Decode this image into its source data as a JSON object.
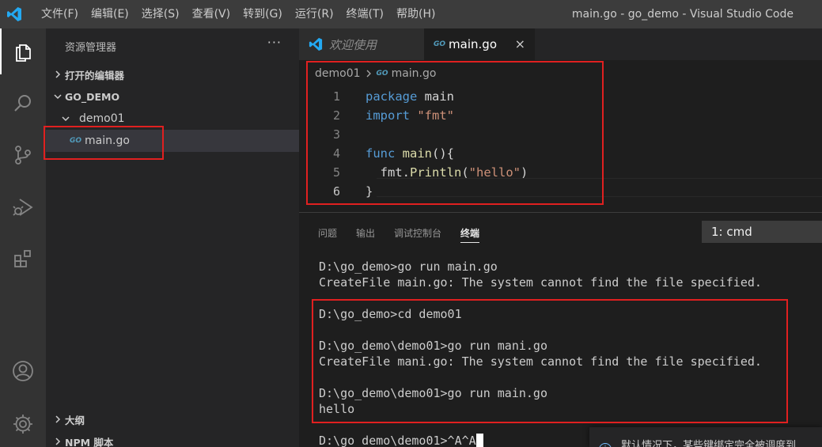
{
  "titlebar": {
    "menu": [
      "文件(F)",
      "编辑(E)",
      "选择(S)",
      "查看(V)",
      "转到(G)",
      "运行(R)",
      "终端(T)",
      "帮助(H)"
    ],
    "window_title": "main.go - go_demo - Visual Studio Code"
  },
  "sidebar": {
    "title": "资源管理器",
    "more": "···",
    "open_editors": "打开的编辑器",
    "workspace": "GO_DEMO",
    "folder": "demo01",
    "file": "main.go",
    "file_icon": "GO",
    "outline": "大纲",
    "npm_scripts": "NPM 脚本"
  },
  "tabs": [
    {
      "label": "欢迎使用",
      "active": false
    },
    {
      "label": "main.go",
      "active": true,
      "icon": "GO",
      "close": "×"
    }
  ],
  "breadcrumb": {
    "folder": "demo01",
    "icon": "GO",
    "file": "main.go"
  },
  "editor": {
    "lines": [
      {
        "n": "1",
        "tokens": [
          [
            "kw",
            "package"
          ],
          [
            "id",
            " main"
          ]
        ]
      },
      {
        "n": "2",
        "tokens": [
          [
            "kw",
            "import"
          ],
          [
            "id",
            " "
          ],
          [
            "st",
            "\"fmt\""
          ]
        ]
      },
      {
        "n": "3",
        "tokens": []
      },
      {
        "n": "4",
        "tokens": [
          [
            "kw",
            "func"
          ],
          [
            "id",
            " "
          ],
          [
            "fn",
            "main"
          ],
          [
            "id",
            "(){"
          ]
        ]
      },
      {
        "n": "5",
        "tokens": [
          [
            "id",
            "  fmt."
          ],
          [
            "fn",
            "Println"
          ],
          [
            "id",
            "("
          ],
          [
            "st",
            "\"hello\""
          ],
          [
            "id",
            ")"
          ]
        ]
      },
      {
        "n": "6",
        "tokens": [
          [
            "id",
            "}"
          ]
        ]
      }
    ]
  },
  "panel": {
    "tabs": [
      "问题",
      "输出",
      "调试控制台",
      "终端"
    ],
    "active_tab": "终端",
    "terminal_select": "1: cmd",
    "terminal_lines": [
      "D:\\go_demo>go run main.go",
      "CreateFile main.go: The system cannot find the file specified.",
      "",
      "D:\\go_demo>cd demo01",
      "",
      "D:\\go_demo\\demo01>go run mani.go",
      "CreateFile mani.go: The system cannot find the file specified.",
      "",
      "D:\\go_demo\\demo01>go run main.go",
      "hello",
      "",
      "D:\\go_demo\\demo01>^A^A"
    ]
  },
  "toast": {
    "icon": "i",
    "text": "默认情况下，某些键绑定完全被调度到"
  },
  "colors": {
    "annotation": "#e02020",
    "accent": "#007acc",
    "go_icon": "#519aba"
  }
}
